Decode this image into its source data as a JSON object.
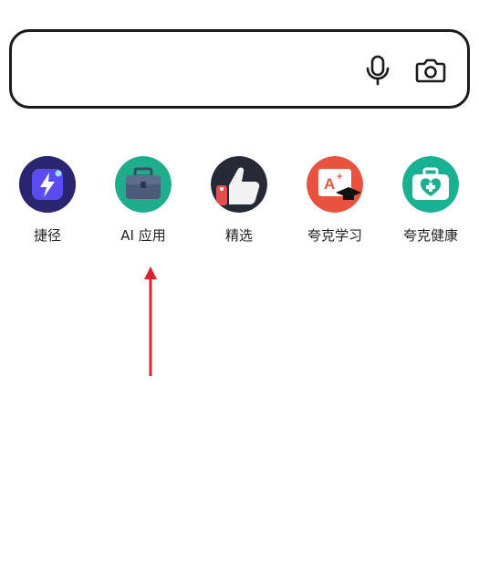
{
  "search": {
    "value": "",
    "icons": [
      "microphone-icon",
      "camera-icon"
    ]
  },
  "shortcuts": [
    {
      "label": "捷径",
      "icon": "lightning-card-icon",
      "color": "#3b2fa8"
    },
    {
      "label": "AI 应用",
      "icon": "briefcase-icon",
      "color": "#1fae8c"
    },
    {
      "label": "精选",
      "icon": "thumbs-up-icon",
      "color": "#2a2e3a"
    },
    {
      "label": "夸克学习",
      "icon": "graduation-board-icon",
      "color": "#e8533f"
    },
    {
      "label": "夸克健康",
      "icon": "medical-kit-icon",
      "color": "#19b193"
    }
  ],
  "annotation": {
    "arrow_color": "#d9262c"
  }
}
